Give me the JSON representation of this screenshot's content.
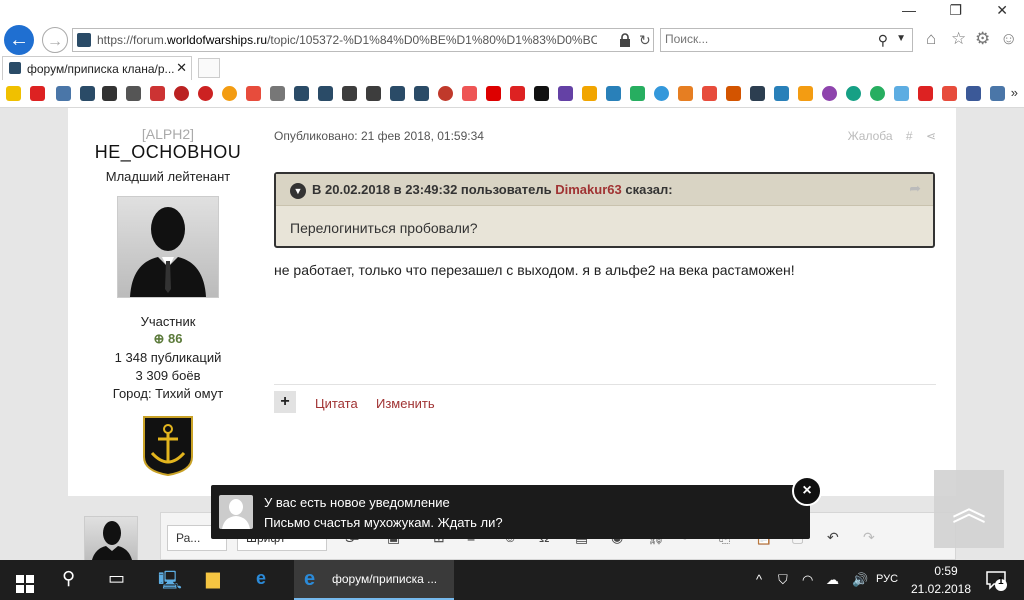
{
  "browser": {
    "url_prefix": "https://forum.",
    "url_domain": "worldofwarships.ru",
    "url_rest": "/topic/105372-%D1%84%D0%BE%D1%80%D1%83%D0%BC%D",
    "search_placeholder": "Поиск...",
    "tab_title": "форум/приписка клана/р...",
    "tab_close": "✕"
  },
  "author": {
    "group": "[ALPH2]",
    "name": "HE_OCHOBHOU",
    "rank": "Младший лейтенант",
    "role": "Участник",
    "reputation": "86",
    "publications": "1 348 публикаций",
    "battles": "3 309 боёв",
    "city": "Город: Тихий омут"
  },
  "post": {
    "date": "Опубликовано: 21 фев 2018, 01:59:34",
    "report": "Жалоба",
    "hash": "#",
    "quote_header_prefix": "В 20.02.2018 в 23:49:32 пользователь",
    "quote_user": "Dimakur63",
    "quote_header_suffix": "сказал:",
    "quote_text": "Перелогиниться пробовали?",
    "text": "не работает, только что перезашел с выходом. я в альфе2 на века растаможен!",
    "quote_btn": "Цитата",
    "edit_btn": "Изменить",
    "plus": "+"
  },
  "editor": {
    "select1": "Ра...",
    "select2": "Шрифт"
  },
  "notification": {
    "title": "У вас есть новое уведомление",
    "message": "Письмо счастья мухожукам. Ждать ли?",
    "close": "×"
  },
  "taskbar": {
    "ie_label": "форум/приписка ...",
    "lang": "РУС",
    "time": "0:59",
    "date": "21.02.2018",
    "notif_count": "1"
  },
  "colors": {
    "accent": "#a03333",
    "rep_green": "#5b7a3a",
    "ie_blue": "#1f6fd1"
  }
}
